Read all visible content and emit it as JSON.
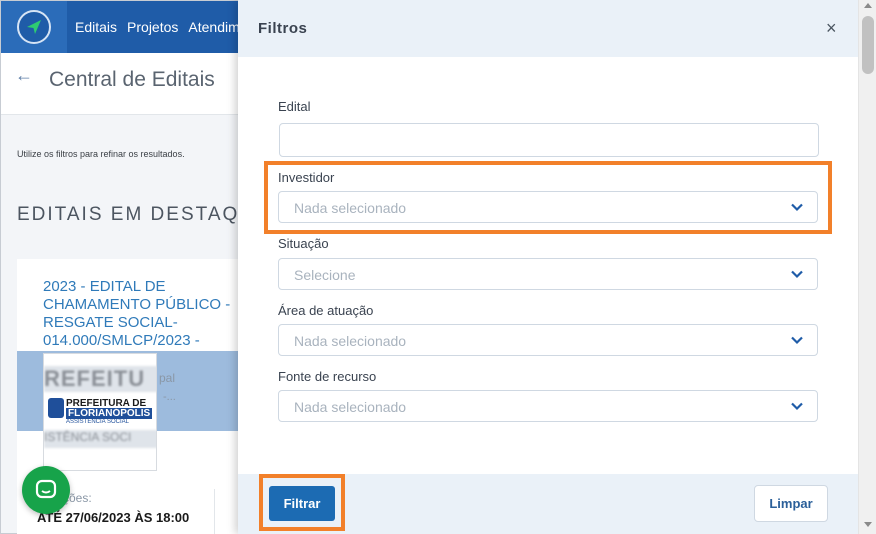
{
  "nav": {
    "items": [
      "Editais",
      "Projetos",
      "Atendime"
    ]
  },
  "page": {
    "title": "Central de Editais",
    "hint": "Utilize os filtros para refinar os resultados.",
    "section_title": "EDITAIS EM DESTAQ"
  },
  "card": {
    "title": "2023 - EDITAL DE CHAMAMENTO PÚBLICO -RESGATE SOCIAL-",
    "title_cut": "014.000/SMLCP/2023 -",
    "band_text1": "pal",
    "band_text2": "-...",
    "logo_blur_top": "REFEITU",
    "logo_line1": "PREFEITURA DE",
    "logo_line2": "FLORIANÓPOLIS",
    "logo_line3": "ASSISTÊNCIA SOCIAL",
    "logo_blur_bot": "ISTÊNCIA SOCI",
    "deadline_label": "ções:",
    "deadline_value": "ATÉ 27/06/2023 ÀS 18:00"
  },
  "drawer": {
    "title": "Filtros",
    "close": "×",
    "fields": {
      "edital": {
        "label": "Edital",
        "value": ""
      },
      "investidor": {
        "label": "Investidor",
        "placeholder": "Nada selecionado"
      },
      "situacao": {
        "label": "Situação",
        "placeholder": "Selecione"
      },
      "area": {
        "label": "Área de atuação",
        "placeholder": "Nada selecionado"
      },
      "fonte": {
        "label": "Fonte de recurso",
        "placeholder": "Nada selecionado"
      }
    },
    "filtrar_label": "Filtrar",
    "limpar_label": "Limpar"
  },
  "colors": {
    "nav_bg": "#1f5ca8",
    "accent": "#1c6bb3",
    "highlight": "#f2802a",
    "chat": "#17a34a"
  }
}
